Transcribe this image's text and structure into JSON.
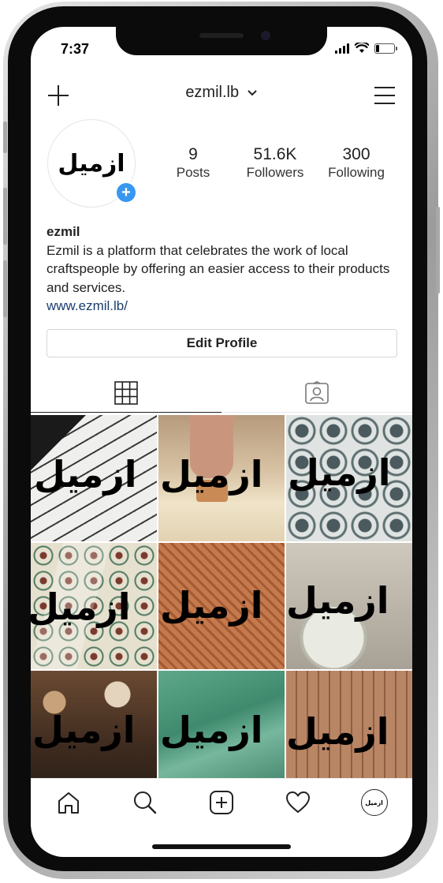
{
  "status_bar": {
    "time": "7:37",
    "battery_level": 0.2
  },
  "header": {
    "username": "ezmil.lb"
  },
  "profile": {
    "avatar_text": "ازميل",
    "stats": [
      {
        "value": "9",
        "label": "Posts"
      },
      {
        "value": "51.6K",
        "label": "Followers"
      },
      {
        "value": "300",
        "label": "Following"
      }
    ],
    "name": "ezmil",
    "bio": "Ezmil is a platform that celebrates the work of local craftspeople by offering an easier access to their products and services.",
    "website": "www.ezmil.lb/",
    "edit_button": "Edit Profile"
  },
  "tabs": [
    {
      "icon": "grid-icon",
      "active": true
    },
    {
      "icon": "tagged-person-icon",
      "active": false
    }
  ],
  "posts": [
    {
      "logo": "ازميل",
      "theme": "woven-fabric"
    },
    {
      "logo": "ازميل",
      "theme": "soap-stamp"
    },
    {
      "logo": "ازميل",
      "theme": "patterned-tiles"
    },
    {
      "logo": "ازميل",
      "theme": "floor-tiles"
    },
    {
      "logo": "ازميل",
      "theme": "wicker-basket"
    },
    {
      "logo": "ازميل",
      "theme": "pottery-wheel"
    },
    {
      "logo": "ازميل",
      "theme": "basket-shop"
    },
    {
      "logo": "ازميل",
      "theme": "green-silk"
    },
    {
      "logo": "ازميل",
      "theme": "knife-workshop"
    }
  ],
  "bottom_nav": {
    "items": [
      "home-icon",
      "search-icon",
      "new-post-icon",
      "activity-heart-icon",
      "profile-avatar-icon"
    ],
    "profile_avatar_text": "ازميل"
  },
  "colors": {
    "accent_blue": "#3897f0",
    "link": "#1b3d6e",
    "text": "#222222",
    "border": "#d6d6d6"
  }
}
